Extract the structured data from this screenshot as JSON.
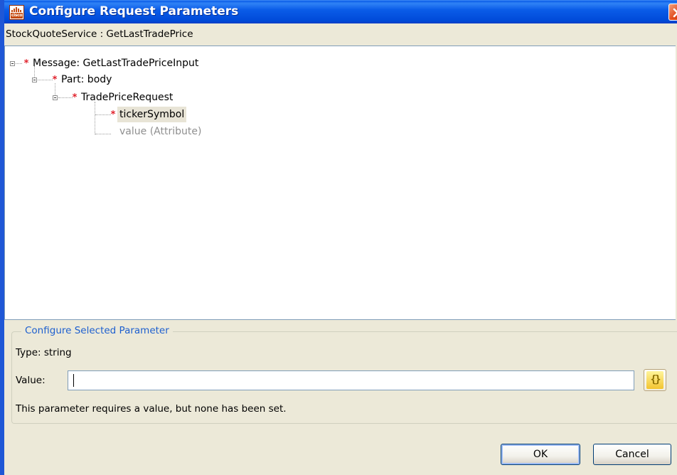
{
  "window": {
    "title": "Configure Request Parameters",
    "app_icon_text": "cisco",
    "app_icon": "cisco-logo-icon",
    "close_icon": "close-icon"
  },
  "service_label": "StockQuoteService : GetLastTradePrice",
  "tree": {
    "nodes": [
      {
        "label": "Message: GetLastTradePriceInput",
        "required": true,
        "expanded": true,
        "level": 0
      },
      {
        "label": "Part: body",
        "required": true,
        "expanded": true,
        "level": 1
      },
      {
        "label": "TradePriceRequest",
        "required": true,
        "expanded": true,
        "level": 2
      },
      {
        "label": "tickerSymbol",
        "required": true,
        "selected": true,
        "level": 3
      },
      {
        "label": "value (Attribute)",
        "required": false,
        "disabled": true,
        "level": 3
      }
    ],
    "required_marker": "*"
  },
  "parameter": {
    "group_title": "Configure Selected Parameter",
    "type_text": "Type:  string",
    "value_label": "Value:",
    "value": "",
    "expression_button_icon": "expression-editor-icon",
    "expression_button_glyph": "{}",
    "message": "This parameter requires a value, but none has been set."
  },
  "buttons": {
    "ok_label": "OK",
    "cancel_label": "Cancel"
  },
  "colors": {
    "title_bar": "#0a5ce8",
    "required_marker": "#e0202a",
    "group_title": "#1d5fcf",
    "window_background": "#ece9d8"
  }
}
